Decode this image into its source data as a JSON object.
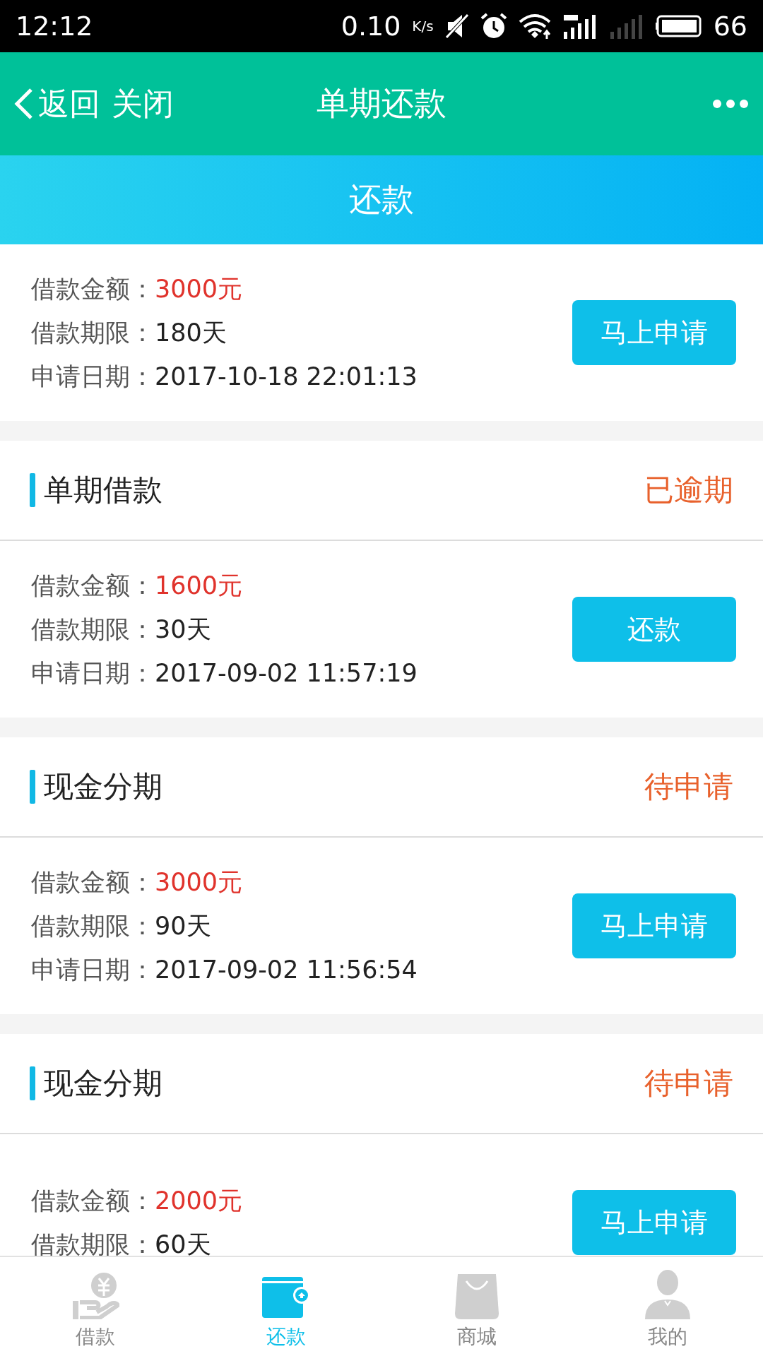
{
  "status_bar": {
    "time": "12:12",
    "speed": "0.10",
    "speed_unit": "K/s",
    "battery": "66"
  },
  "header": {
    "back": "返回",
    "close": "关闭",
    "title": "单期还款"
  },
  "banner": {
    "title": "还款"
  },
  "loans": [
    {
      "lines": [
        {
          "kind": "amount",
          "label": "借款金额：",
          "value": "3000元"
        },
        {
          "kind": "plain",
          "label": "借款期限：",
          "value": "180天"
        },
        {
          "kind": "plain",
          "label": "申请日期：",
          "value": "2017-10-18 22:01:13"
        }
      ],
      "button": "马上申请"
    },
    {
      "section": {
        "title": "单期借款",
        "status": "已逾期"
      },
      "lines": [
        {
          "kind": "amount",
          "label": "借款金额：",
          "value": "1600元"
        },
        {
          "kind": "plain",
          "label": "借款期限：",
          "value": "30天"
        },
        {
          "kind": "plain",
          "label": "申请日期：",
          "value": "2017-09-02 11:57:19"
        }
      ],
      "button": "还款"
    },
    {
      "section": {
        "title": "现金分期",
        "status": "待申请"
      },
      "lines": [
        {
          "kind": "amount",
          "label": "借款金额：",
          "value": "3000元"
        },
        {
          "kind": "plain",
          "label": "借款期限：",
          "value": "90天"
        },
        {
          "kind": "plain",
          "label": "申请日期：",
          "value": "2017-09-02 11:56:54"
        }
      ],
      "button": "马上申请"
    },
    {
      "section": {
        "title": "现金分期",
        "status": "待申请"
      },
      "lines": [
        {
          "kind": "amount",
          "label": "借款金额：",
          "value": "2000元"
        },
        {
          "kind": "plain",
          "label": "借款期限：",
          "value": "60天"
        }
      ],
      "button": "马上申请"
    }
  ],
  "nav": [
    {
      "kind": "loan",
      "label": "借款",
      "selected": false
    },
    {
      "kind": "wallet",
      "label": "还款",
      "selected": true
    },
    {
      "kind": "bag",
      "label": "商城",
      "selected": false
    },
    {
      "kind": "user",
      "label": "我的",
      "selected": false
    }
  ]
}
